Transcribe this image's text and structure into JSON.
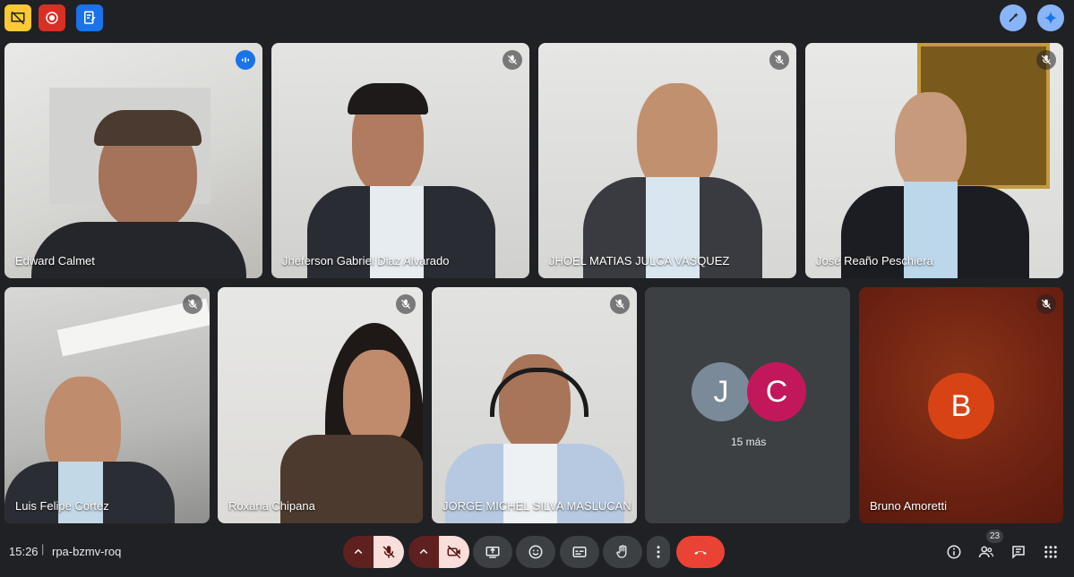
{
  "meeting": {
    "time": "15:26",
    "separator": "|",
    "code": "rpa-bzmv-roq"
  },
  "top_bar": {
    "left_icons": [
      "no-presentation-icon",
      "record-icon",
      "notes-icon"
    ],
    "right_icons": [
      "effects-wand-icon",
      "gemini-icon"
    ]
  },
  "participants": [
    {
      "name": "Edward Calmet",
      "speaking": true,
      "muted": false
    },
    {
      "name": "Jheferson Gabriel Diaz Alvarado",
      "muted": true
    },
    {
      "name": "JHOEL MATIAS JULCA VASQUEZ",
      "muted": true
    },
    {
      "name": "José Reaño Peschiera",
      "muted": true
    },
    {
      "name": "Luis Felipe Cortez",
      "muted": true
    },
    {
      "name": "Roxana Chipana",
      "muted": true
    },
    {
      "name": "JORGE MICHEL SILVA MASLUCAN",
      "muted": true
    }
  ],
  "more_tile": {
    "avatars": [
      "J",
      "C"
    ],
    "label": "15 más"
  },
  "bruno_tile": {
    "initial": "B",
    "name": "Bruno Amoretti",
    "muted": true
  },
  "controls": {
    "mic": "mic-off-icon",
    "camera": "camera-off-icon",
    "items": [
      "present-icon",
      "emoji-icon",
      "captions-icon",
      "raise-hand-icon",
      "more-options-icon",
      "end-call-icon"
    ]
  },
  "right_controls": {
    "icons": [
      "info-icon",
      "people-icon",
      "chat-icon",
      "activities-icon"
    ],
    "people_count": "23"
  },
  "colors": {
    "background": "#202124",
    "speaking_border": "#8ab4f8",
    "end_call": "#ea4335",
    "avatar_j": "#7a8a98",
    "avatar_c": "#c2185b",
    "avatar_b": "#d84315"
  }
}
